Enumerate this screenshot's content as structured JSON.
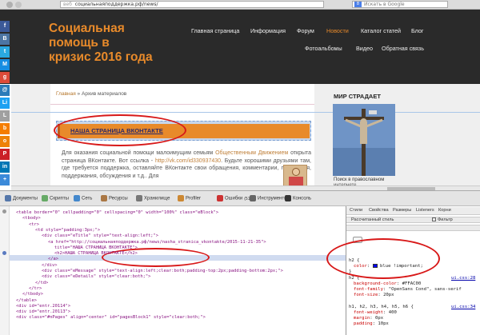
{
  "browser": {
    "url_scheme": "веб",
    "url": "социальнаяподдержка.рф/news/",
    "search_placeholder": "Искать в Google",
    "search_engine_badge": "8"
  },
  "site": {
    "title_line1": "Социальная помощь в",
    "title_line2": "кризис 2016 года",
    "nav": [
      {
        "label": "Главная страница"
      },
      {
        "label": "Информация"
      },
      {
        "label": "Форум"
      },
      {
        "label": "Новости",
        "active": true
      },
      {
        "label": "Каталог статей"
      },
      {
        "label": "Блог"
      },
      {
        "label": "Фотоальбомы"
      },
      {
        "label": "Видео"
      },
      {
        "label": "Обратная связь"
      }
    ]
  },
  "social": [
    {
      "letter": "f",
      "icon": "facebook-icon",
      "color": "#3b5998"
    },
    {
      "letter": "B",
      "icon": "vkontakte-icon",
      "color": "#4c75a3"
    },
    {
      "letter": "t",
      "icon": "twitter-icon",
      "color": "#2aa9e0"
    },
    {
      "letter": "M",
      "icon": "mail-icon",
      "color": "#168de2"
    },
    {
      "letter": "g",
      "icon": "google-plus-icon",
      "color": "#dd4b39"
    },
    {
      "letter": "@",
      "icon": "email-icon",
      "color": "#2b7bb9"
    },
    {
      "letter": "Li",
      "icon": "livejournal-icon",
      "color": "#1da1f2"
    },
    {
      "letter": "L",
      "icon": "liveinternet-icon",
      "color": "#a0a0a0"
    },
    {
      "letter": "b",
      "icon": "blogger-icon",
      "color": "#f57d00"
    },
    {
      "letter": "o",
      "icon": "odnoklassniki-icon",
      "color": "#ee8208"
    },
    {
      "letter": "P",
      "icon": "pinterest-icon",
      "color": "#cb2027"
    },
    {
      "letter": "in",
      "icon": "linkedin-icon",
      "color": "#0077b5"
    },
    {
      "letter": "+",
      "icon": "share-more-icon",
      "color": "#3b8ad9"
    }
  ],
  "content": {
    "breadcrumb_home": "Главная",
    "breadcrumb_sep": " » ",
    "breadcrumb_current": "Архив материалов",
    "heading": "НАША СТРАНИЦА ВКОНТАКТЕ",
    "body_p1a": "Для",
    "body_p1b": "оказания социальной помощи малоимущим семьям",
    "body_link1": "Общественным Движением",
    "body_p2": "открыта страница ВКонтакте. Вот ссылка -",
    "body_link2": "http://vk.com/id330937430",
    "body_p3": ". Будьте хорошими друзьями там, где требуется поддержка, оставляйте ВКонтакте свои обращения, комментарии, пожелания, поддержания, обсуждения и т.д.. Для"
  },
  "sidebar": {
    "title": "МИР СТРАДАЕТ",
    "caption": "Поиск в православном",
    "caption2": "интернете"
  },
  "devtools": {
    "tabs": [
      {
        "label": "Документы",
        "icon": "document-icon",
        "color": "#5577aa"
      },
      {
        "label": "Скрипты",
        "icon": "scripts-icon",
        "color": "#66aa66"
      },
      {
        "label": "Сеть",
        "icon": "network-icon",
        "color": "#4488cc"
      },
      {
        "label": "Ресурсы",
        "icon": "resources-icon",
        "color": "#aa7744"
      },
      {
        "label": "Хранилище",
        "icon": "storage-icon",
        "color": "#777777"
      },
      {
        "label": "Profiler",
        "icon": "profiler-icon",
        "color": "#cc8833"
      },
      {
        "label": "Ошибки",
        "sub": "(511)",
        "icon": "errors-icon",
        "color": "#cc3333"
      },
      {
        "label": "Инструменты",
        "icon": "utilities-icon",
        "color": "#666666"
      },
      {
        "label": "Консоль",
        "icon": "console-icon",
        "color": "#333333"
      }
    ],
    "dom_lines": [
      {
        "indent": 0,
        "open": "<table border=\"0\" cellpadding=\"0\" cellspacing=\"0\" width=\"100%\" class=\"eBlock\">",
        "sel": false
      },
      {
        "indent": 1,
        "open": "<tbody>",
        "sel": false
      },
      {
        "indent": 2,
        "open": "<tr>",
        "sel": false
      },
      {
        "indent": 3,
        "open": "<td style=\"padding:3px;\">",
        "sel": false
      },
      {
        "indent": 4,
        "open": "<div class=\"eTitle\" style=\"text-align:left;\">",
        "sel": false
      },
      {
        "indent": 5,
        "open": "<a href=\"http://социальнаяподдержка.рф/news/nasha_stranica_vkontakte/2015-11-21-35\">",
        "sel": false
      },
      {
        "indent": 6,
        "open": "title=\"НАША СТРАНИЦА ВКОНТАКТЕ\">",
        "sel": false
      },
      {
        "indent": 6,
        "open": "<h2>НАША СТРАНИЦА ВКОНТАКТЕ</h2>",
        "sel": true
      },
      {
        "indent": 5,
        "open": "</a>",
        "sel": false
      },
      {
        "indent": 4,
        "open": "</div>",
        "sel": false
      },
      {
        "indent": 4,
        "open": "<div class=\"eMessage\" style=\"text-align:left;clear:both;padding-top:2px;padding-bottom:2px;\">",
        "sel": false
      },
      {
        "indent": 4,
        "open": "<div class=\"eDetails\" style=\"clear:both;\">",
        "sel": false
      },
      {
        "indent": 3,
        "open": "</td>",
        "sel": false
      },
      {
        "indent": 2,
        "open": "</tr>",
        "sel": false
      },
      {
        "indent": 1,
        "open": "</tbody>",
        "sel": false
      },
      {
        "indent": 0,
        "open": "</table>",
        "sel": false
      },
      {
        "indent": 0,
        "open": "<div id=\"entr.20114\">",
        "sel": false
      },
      {
        "indent": 0,
        "open": "<div id=\"entr.20113\">",
        "sel": false
      },
      {
        "indent": 0,
        "open": "<div class=\"#nPages\" align=\"center\" id=\"pagesBlock1\" style=\"clear:both;\">",
        "sel": false
      }
    ],
    "right_tabs": [
      "Стили",
      "Свойства",
      "Размеры",
      "Listeners",
      "Корни"
    ],
    "computed_label": "Рассчитанный стиль",
    "show_inherited": "Фильтр",
    "rule1_selector": "h2 {",
    "rule1_prop": "color",
    "rule1_value": "blue",
    "rule1_important": "!important;",
    "rule1_close": "}",
    "rule2_selector": "h2 {",
    "rule2_src": "ui.css:28",
    "rule2_props": [
      {
        "p": "background-color",
        "v": "#FFAC00"
      },
      {
        "p": "font-family",
        "v": "\"OpenSans Cond\", sans-serif"
      },
      {
        "p": "font-size",
        "v": "20px"
      }
    ],
    "rule3_selector": "h1, h2, h3, h4, h5, h6 {",
    "rule3_src": "ui.css:34",
    "rule3_props": [
      {
        "p": "font-weight",
        "v": "400"
      },
      {
        "p": "margin",
        "v": "0px"
      },
      {
        "p": "padding",
        "v": "10px"
      }
    ]
  },
  "colors": {
    "accent": "#e88a2a",
    "annotation": "#d81818"
  }
}
